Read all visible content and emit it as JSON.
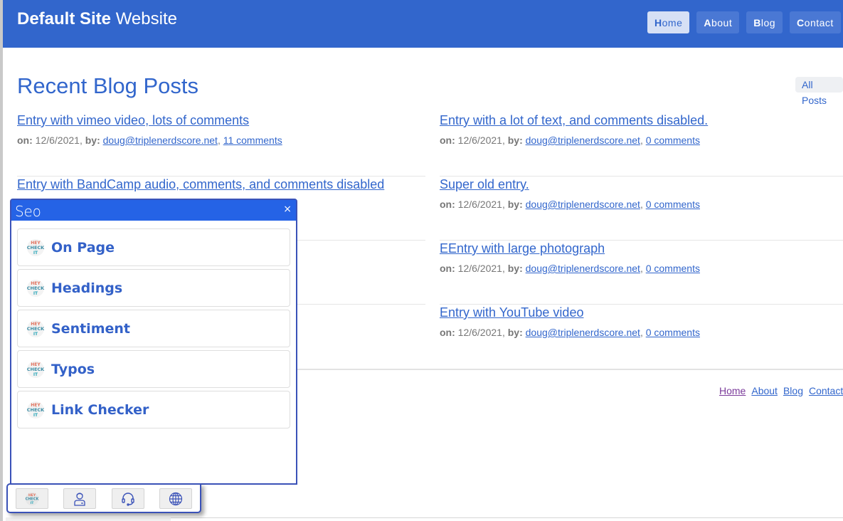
{
  "header": {
    "title_bold": "Default Site",
    "title_light": "Website",
    "nav": [
      {
        "first": "H",
        "rest": "ome",
        "active": true
      },
      {
        "first": "A",
        "rest": "bout",
        "active": false
      },
      {
        "first": "B",
        "rest": "log",
        "active": false
      },
      {
        "first": "C",
        "rest": "ontact",
        "active": false
      }
    ]
  },
  "main": {
    "title": "Recent Blog Posts",
    "all_posts_label": "All Posts",
    "meta_on_label": "on:",
    "meta_by_label": "by:",
    "posts_left": [
      {
        "title": "Entry with vimeo video, lots of comments",
        "date": "12/6/2021",
        "author": "doug@triplenerdscore.net",
        "comments": "11 comments"
      },
      {
        "title": "Entry with BandCamp audio, comments, and comments disabled",
        "date": "",
        "author": "",
        "comments": ""
      }
    ],
    "posts_right": [
      {
        "title": "Entry with a lot of text, and comments disabled.",
        "date": "12/6/2021",
        "author": "doug@triplenerdscore.net",
        "comments": "0 comments"
      },
      {
        "title": "Super old entry.",
        "date": "12/6/2021",
        "author": "doug@triplenerdscore.net",
        "comments": "0 comments"
      },
      {
        "title": "EEntry with large photograph",
        "date": "12/6/2021",
        "author": "doug@triplenerdscore.net",
        "comments": "0 comments"
      },
      {
        "title": "Entry with YouTube video",
        "date": "12/6/2021",
        "author": "doug@triplenerdscore.net",
        "comments": "0 comments"
      }
    ]
  },
  "footer": {
    "links": [
      "Home",
      "About",
      "Blog",
      "Contact"
    ]
  },
  "seo_panel": {
    "title": "Seo",
    "close_symbol": "×",
    "items": [
      {
        "label": "On Page",
        "icon": "hey-check-it-logo-icon"
      },
      {
        "label": "Headings",
        "icon": "hey-check-it-logo-icon"
      },
      {
        "label": "Sentiment",
        "icon": "hey-check-it-logo-icon"
      },
      {
        "label": "Typos",
        "icon": "hey-check-it-logo-icon"
      },
      {
        "label": "Link Checker",
        "icon": "hey-check-it-logo-icon"
      }
    ],
    "toolbar": [
      {
        "icon": "hey-check-it-logo-icon"
      },
      {
        "icon": "user-icon"
      },
      {
        "icon": "headset-icon"
      },
      {
        "icon": "globe-icon"
      }
    ]
  },
  "colors": {
    "brand": "#3266cc",
    "panel_header": "#2563e6",
    "panel_border": "#3a52b8"
  }
}
